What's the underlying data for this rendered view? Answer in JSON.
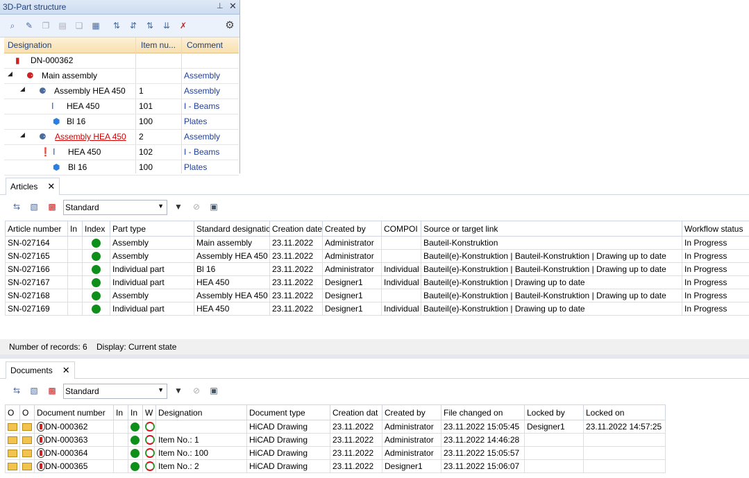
{
  "part_structure": {
    "title": "3D-Part structure",
    "pin_icon": "pin-icon",
    "close_icon": "close-icon",
    "columns": [
      "Designation",
      "Item nu...",
      "Comment"
    ],
    "rows": [
      {
        "designation": "DN-000362",
        "item": "",
        "comment": ""
      },
      {
        "designation": "Main assembly",
        "item": "",
        "comment": "Assembly"
      },
      {
        "designation": "Assembly HEA 450",
        "item": "1",
        "comment": "Assembly"
      },
      {
        "designation": "HEA 450",
        "item": "101",
        "comment": "I - Beams"
      },
      {
        "designation": "Bl 16",
        "item": "100",
        "comment": "Plates"
      },
      {
        "designation": "Assembly HEA 450",
        "item": "2",
        "comment": "Assembly"
      },
      {
        "designation": "HEA 450",
        "item": "102",
        "comment": "I - Beams"
      },
      {
        "designation": "Bl 16",
        "item": "100",
        "comment": "Plates"
      }
    ],
    "highlight_color": "#d40000"
  },
  "articles": {
    "tab_label": "Articles",
    "view_select": "Standard",
    "columns": [
      "Article number",
      "In",
      "Index",
      "Part type",
      "Standard designatio",
      "Creation date",
      "Created by",
      "COMPOI",
      "Source or target link",
      "Workflow status"
    ],
    "rows": [
      {
        "number": "SN-027164",
        "part_type": "Assembly",
        "std": "Main assembly",
        "date": "23.11.2022",
        "by": "Administrator",
        "comp": "",
        "link": "Bauteil-Konstruktion",
        "status": "In Progress"
      },
      {
        "number": "SN-027165",
        "part_type": "Assembly",
        "std": "Assembly HEA 450",
        "date": "23.11.2022",
        "by": "Administrator",
        "comp": "",
        "link": "Bauteil(e)-Konstruktion | Bauteil-Konstruktion | Drawing up to date",
        "status": "In Progress"
      },
      {
        "number": "SN-027166",
        "part_type": "Individual part",
        "std": "Bl 16",
        "date": "23.11.2022",
        "by": "Administrator",
        "comp": "Individual",
        "link": "Bauteil(e)-Konstruktion | Bauteil-Konstruktion | Drawing up to date",
        "status": "In Progress"
      },
      {
        "number": "SN-027167",
        "part_type": "Individual part",
        "std": "HEA 450",
        "date": "23.11.2022",
        "by": "Designer1",
        "comp": "Individual",
        "link": "Bauteil(e)-Konstruktion | Drawing up to date",
        "status": "In Progress"
      },
      {
        "number": "SN-027168",
        "part_type": "Assembly",
        "std": "Assembly HEA 450",
        "date": "23.11.2022",
        "by": "Designer1",
        "comp": "",
        "link": "Bauteil(e)-Konstruktion | Bauteil-Konstruktion | Drawing up to date",
        "status": "In Progress"
      },
      {
        "number": "SN-027169",
        "part_type": "Individual part",
        "std": "HEA 450",
        "date": "23.11.2022",
        "by": "Designer1",
        "comp": "Individual",
        "link": "Bauteil(e)-Konstruktion | Drawing up to date",
        "status": "In Progress"
      }
    ],
    "status_records": "Number of records: 6",
    "status_display": "Display: Current state"
  },
  "documents": {
    "tab_label": "Documents",
    "view_select": "Standard",
    "columns": [
      "O",
      "O",
      "Document number",
      "In",
      "In",
      "W",
      "Designation",
      "Document type",
      "Creation dat",
      "Created by",
      "File changed on",
      "Locked by",
      "Locked on"
    ],
    "rows": [
      {
        "number": "DN-000362",
        "designation": "",
        "type": "HiCAD Drawing",
        "date": "23.11.2022",
        "by": "Administrator",
        "changed": "23.11.2022 15:05:45",
        "locked_by": "Designer1",
        "locked_on": "23.11.2022 14:57:25"
      },
      {
        "number": "DN-000363",
        "designation": "Item No.: 1",
        "type": "HiCAD Drawing",
        "date": "23.11.2022",
        "by": "Administrator",
        "changed": "23.11.2022 14:46:28",
        "locked_by": "",
        "locked_on": ""
      },
      {
        "number": "DN-000364",
        "designation": "Item No.: 100",
        "type": "HiCAD Drawing",
        "date": "23.11.2022",
        "by": "Administrator",
        "changed": "23.11.2022 15:05:57",
        "locked_by": "",
        "locked_on": ""
      },
      {
        "number": "DN-000365",
        "designation": "Item No.: 2",
        "type": "HiCAD Drawing",
        "date": "23.11.2022",
        "by": "Designer1",
        "changed": "23.11.2022 15:06:07",
        "locked_by": "",
        "locked_on": ""
      }
    ]
  }
}
